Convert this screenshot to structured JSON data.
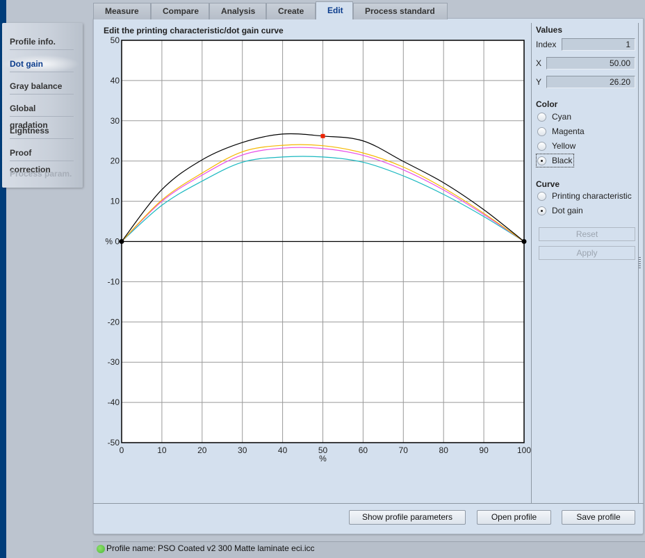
{
  "tabs": [
    {
      "label": "Measure",
      "active": false
    },
    {
      "label": "Compare",
      "active": false
    },
    {
      "label": "Analysis",
      "active": false
    },
    {
      "label": "Create",
      "active": false
    },
    {
      "label": "Edit",
      "active": true
    },
    {
      "label": "Process standard",
      "active": false
    }
  ],
  "sidebar": {
    "items": [
      {
        "label": "Profile info.",
        "state": "normal"
      },
      {
        "label": "Dot gain",
        "state": "active"
      },
      {
        "label": "Gray balance",
        "state": "normal"
      },
      {
        "label": "Global gradation",
        "state": "normal"
      },
      {
        "label": "Lightness",
        "state": "normal"
      },
      {
        "label": "Proof correction",
        "state": "normal"
      },
      {
        "label": "Process param.",
        "state": "disabled"
      }
    ]
  },
  "values_panel": {
    "header": "Values",
    "index_label": "Index",
    "index_value": "1",
    "x_label": "X",
    "x_value": "50.00",
    "y_label": "Y",
    "y_value": "26.20"
  },
  "color_panel": {
    "header": "Color",
    "options": [
      "Cyan",
      "Magenta",
      "Yellow",
      "Black"
    ],
    "selected": "Black"
  },
  "curve_panel": {
    "header": "Curve",
    "options": [
      "Printing characteristic",
      "Dot gain"
    ],
    "selected": "Dot gain",
    "reset_label": "Reset",
    "apply_label": "Apply"
  },
  "buttons": {
    "show_params": "Show profile parameters",
    "open_profile": "Open profile",
    "save_profile": "Save profile"
  },
  "status": {
    "text": "Profile name: PSO  Coated  v2  300  Matte  laminate  eci.icc",
    "indicator_color": "#5cc846"
  },
  "chart_data": {
    "type": "line",
    "title": "Edit the printing characteristic/dot gain curve",
    "xlabel": "%",
    "ylabel": "%",
    "xlim": [
      0,
      100
    ],
    "ylim": [
      -50,
      50
    ],
    "x_ticks": [
      "0",
      "10",
      "20",
      "30",
      "40",
      "50",
      "60",
      "70",
      "80",
      "90",
      "100"
    ],
    "y_ticks": [
      "50",
      "40",
      "30",
      "20",
      "10",
      "% 0",
      "-10",
      "-20",
      "-30",
      "-40",
      "-50"
    ],
    "grid": true,
    "x": [
      0,
      10,
      20,
      30,
      40,
      50,
      60,
      70,
      80,
      90,
      100
    ],
    "series": [
      {
        "name": "Black",
        "color": "#000000",
        "values": [
          0,
          12.9,
          20.3,
          24.6,
          26.7,
          26.2,
          25.0,
          19.9,
          14.6,
          7.9,
          0
        ]
      },
      {
        "name": "Yellow",
        "color": "#f5b800",
        "values": [
          0,
          10.3,
          17.0,
          22.3,
          23.9,
          23.8,
          22.0,
          18.5,
          13.3,
          7.0,
          0
        ]
      },
      {
        "name": "Magenta",
        "color": "#e84ee8",
        "values": [
          0,
          10.0,
          16.5,
          21.5,
          23.2,
          23.1,
          21.4,
          17.8,
          12.8,
          6.7,
          0
        ]
      },
      {
        "name": "Cyan",
        "color": "#1ab8c0",
        "values": [
          0,
          9.0,
          15.0,
          19.7,
          21.0,
          21.0,
          19.7,
          16.3,
          11.7,
          6.2,
          0
        ]
      }
    ],
    "selected_point": {
      "series": "Black",
      "x": 50,
      "y": 26.2,
      "color": "#ee2200"
    },
    "endpoints": [
      {
        "x": 0,
        "y": 0
      },
      {
        "x": 100,
        "y": 0
      }
    ]
  }
}
